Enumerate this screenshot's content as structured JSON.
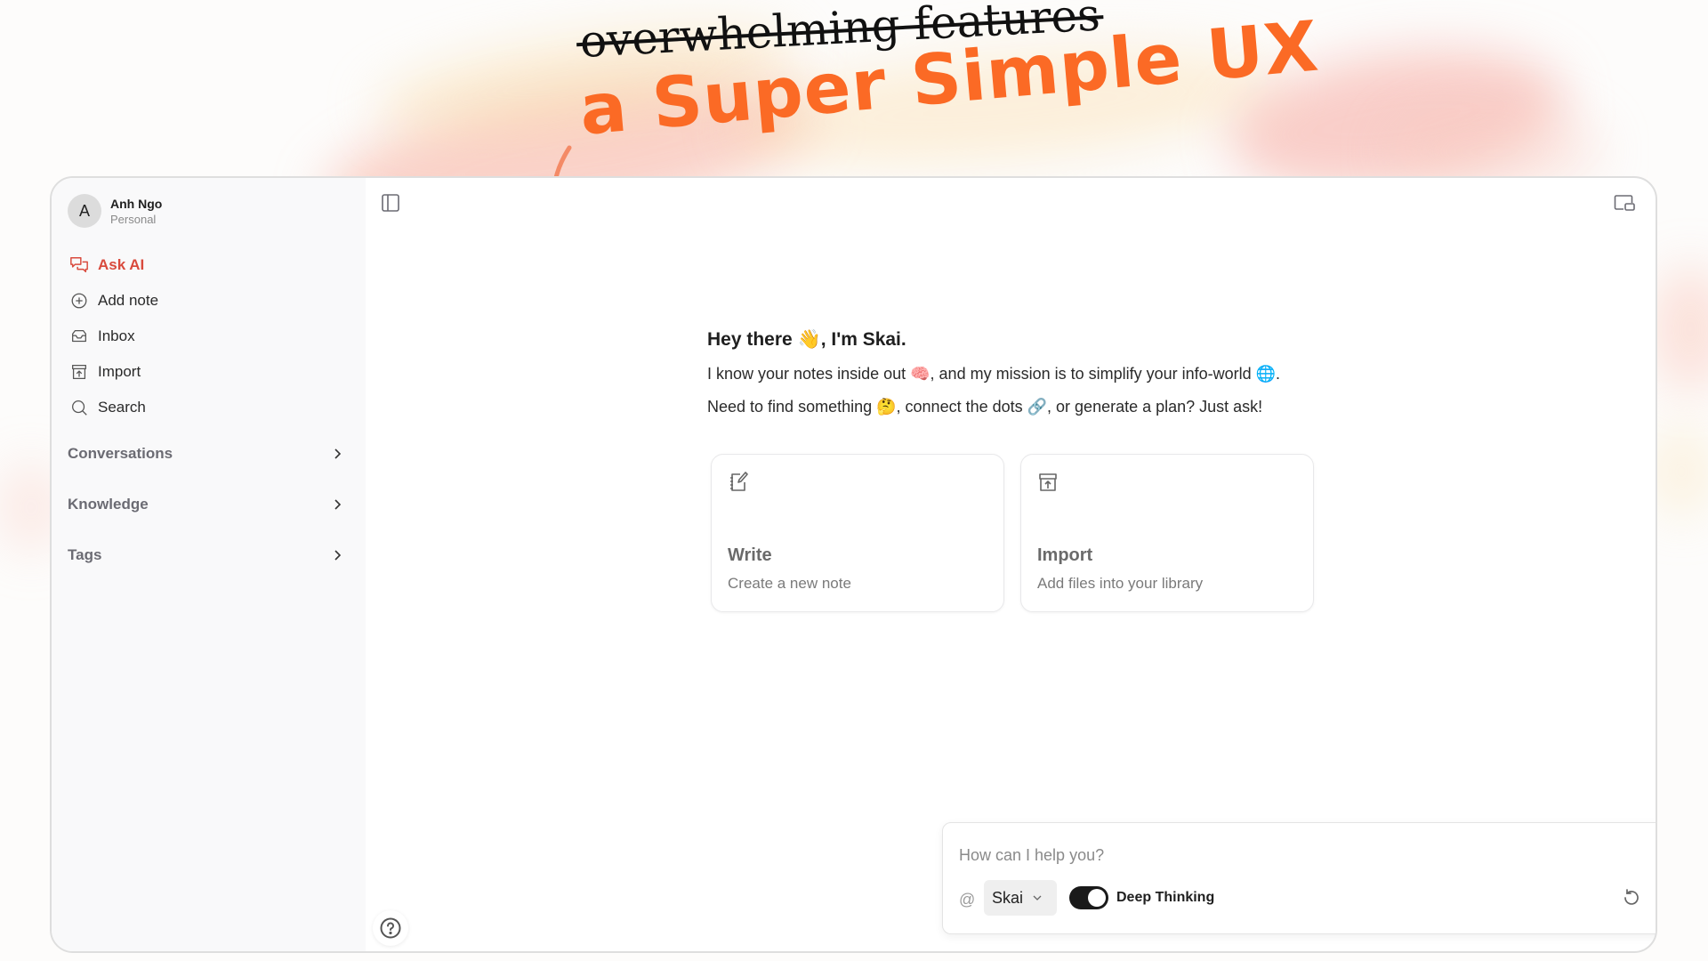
{
  "banner": {
    "struck_text": "overwhelming features",
    "headline": "a Super Simple UX"
  },
  "sidebar": {
    "user": {
      "initial": "A",
      "name": "Anh Ngo",
      "workspace": "Personal"
    },
    "nav": [
      {
        "label": "Ask AI",
        "icon": "chat-bubbles-icon",
        "active": true
      },
      {
        "label": "Add note",
        "icon": "plus-circle-icon"
      },
      {
        "label": "Inbox",
        "icon": "inbox-icon"
      },
      {
        "label": "Import",
        "icon": "import-archive-icon"
      },
      {
        "label": "Search",
        "icon": "search-icon"
      }
    ],
    "sections": [
      {
        "label": "Conversations"
      },
      {
        "label": "Knowledge"
      },
      {
        "label": "Tags"
      }
    ]
  },
  "main": {
    "greeting": {
      "title": "Hey there 👋, I'm Skai.",
      "line1": "I know your notes inside out 🧠, and my mission is to simplify your info-world 🌐.",
      "line2": "Need to find something 🤔, connect the dots 🔗, or generate a plan? Just ask!"
    },
    "cards": [
      {
        "title": "Write",
        "subtitle": "Create a new note",
        "icon": "notebook-pen-icon"
      },
      {
        "title": "Import",
        "subtitle": "Add files into your library",
        "icon": "import-archive-icon"
      }
    ],
    "composer": {
      "placeholder": "How can I help you?",
      "value": "",
      "mention_symbol": "@",
      "model": "Skai",
      "toggle_label": "Deep Thinking",
      "toggle_on": true
    }
  },
  "colors": {
    "accent": "#fb6a25",
    "active_nav": "#d94a3d"
  }
}
